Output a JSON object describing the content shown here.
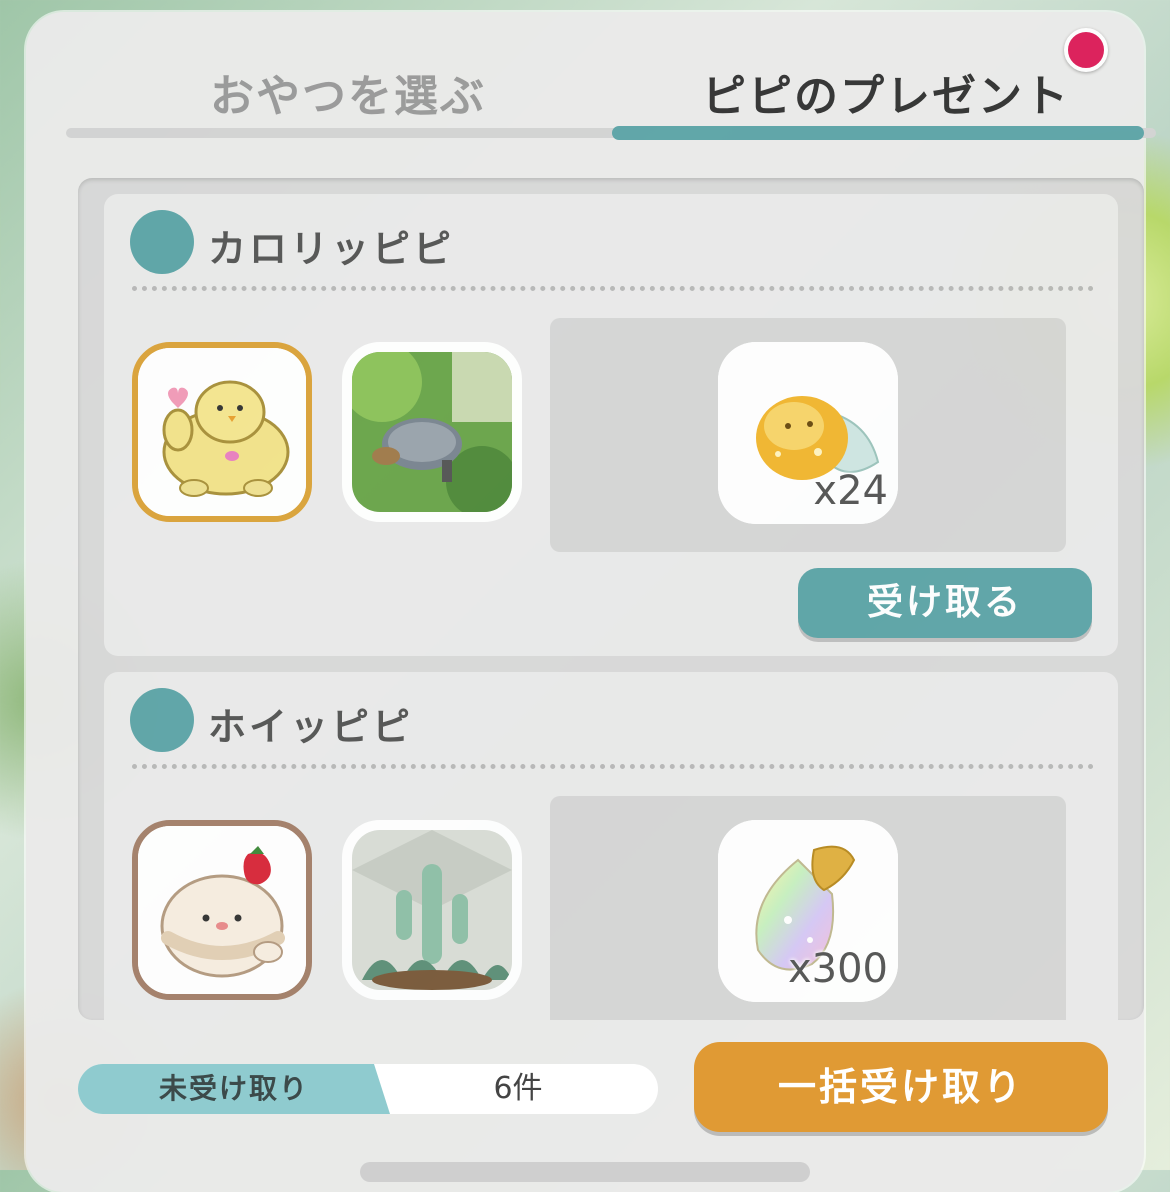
{
  "tabs": [
    {
      "label": "おやつを選ぶ",
      "active": false
    },
    {
      "label": "ピピのプレゼント",
      "active": true
    }
  ],
  "notification_badge": true,
  "cards": [
    {
      "pipi_name": "カロリッピピ",
      "character_icon": "yellow-chick-pipi-icon",
      "scene_icon": "turtle-scene-icon",
      "reward_icon": "gold-coin-bird-icon",
      "reward_qty": "x24",
      "receive_label": "受け取る"
    },
    {
      "pipi_name": "ホイッピピ",
      "character_icon": "whipped-cream-pipi-icon",
      "scene_icon": "cactus-scene-icon",
      "reward_icon": "rainbow-gem-icon",
      "reward_qty": "x300"
    }
  ],
  "footer": {
    "status_label": "未受け取り",
    "status_count": "6件",
    "bulk_label": "一括受け取り"
  },
  "colors": {
    "accent": "#5ea5a8",
    "bulk_button": "#e09a34",
    "badge": "#dd1e5a"
  }
}
